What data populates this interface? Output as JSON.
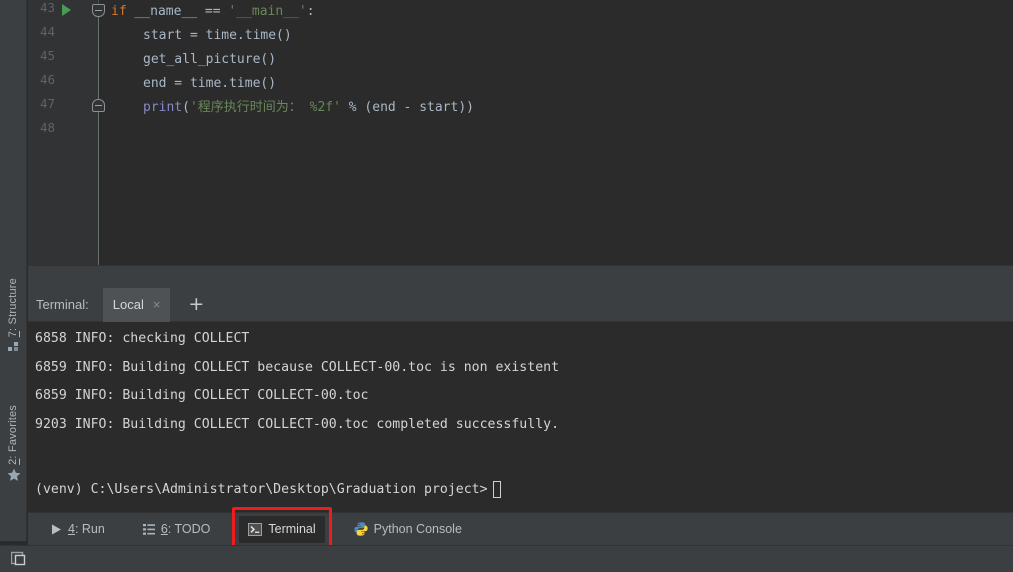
{
  "editor": {
    "lines": [
      {
        "num": "43",
        "tokens": [
          {
            "t": "if",
            "c": "kw"
          },
          {
            "t": " __name__ == ",
            "c": "pl"
          },
          {
            "t": "'__main__'",
            "c": "str"
          },
          {
            "t": ":",
            "c": "pl"
          }
        ],
        "indent": 0
      },
      {
        "num": "44",
        "tokens": [
          {
            "t": "start = time.time()",
            "c": "pl"
          }
        ],
        "indent": 1
      },
      {
        "num": "45",
        "tokens": [
          {
            "t": "get_all_picture()",
            "c": "pl"
          }
        ],
        "indent": 1
      },
      {
        "num": "46",
        "tokens": [
          {
            "t": "end = time.time()",
            "c": "pl"
          }
        ],
        "indent": 1
      },
      {
        "num": "47",
        "tokens": [
          {
            "t": "print",
            "c": "bi"
          },
          {
            "t": "(",
            "c": "pl"
          },
          {
            "t": "'程序执行时间为： %2f'",
            "c": "str"
          },
          {
            "t": " % (end - start))",
            "c": "pl"
          }
        ],
        "indent": 1
      },
      {
        "num": "48",
        "tokens": [],
        "indent": 0
      }
    ],
    "run_marker_line": "43",
    "fold_markers": [
      "43",
      "47"
    ]
  },
  "sidebar": {
    "items": [
      {
        "name": "structure",
        "key": "7",
        "label": "7: Structure",
        "icon": "structure-icon"
      },
      {
        "name": "favorites",
        "key": "2",
        "label": "2: Favorites",
        "icon": "star-icon"
      }
    ]
  },
  "terminal": {
    "label": "Terminal:",
    "tab": {
      "title": "Local",
      "close": "×"
    },
    "add_button": "+",
    "output_lines": [
      "6858 INFO: checking COLLECT",
      "6859 INFO: Building COLLECT because COLLECT-00.toc is non existent",
      "6859 INFO: Building COLLECT COLLECT-00.toc",
      "9203 INFO: Building COLLECT COLLECT-00.toc completed successfully.",
      ""
    ],
    "prompt": "(venv) C:\\Users\\Administrator\\Desktop\\Graduation project>"
  },
  "bottom_bar": {
    "buttons": [
      {
        "name": "run",
        "key": "4",
        "pre": "",
        "keytxt": "4",
        "post": ": Run",
        "icon": "play-icon",
        "active": false
      },
      {
        "name": "todo",
        "key": "6",
        "pre": "",
        "keytxt": "6",
        "post": ": TODO",
        "icon": "list-icon",
        "active": false
      },
      {
        "name": "terminal",
        "key": "",
        "pre": "Terminal",
        "keytxt": "",
        "post": "",
        "icon": "terminal-icon",
        "active": true
      },
      {
        "name": "python-console",
        "key": "",
        "pre": "Python Console",
        "keytxt": "",
        "post": "",
        "icon": "python-icon",
        "active": false
      }
    ],
    "highlight_target": "terminal"
  },
  "colors": {
    "background": "#2b2b2b",
    "panel": "#3c3f41",
    "gutter": "#313335",
    "text": "#a9b7c6",
    "keyword": "#cc7832",
    "string": "#6a8759",
    "builtin": "#8888c6",
    "run_green": "#499c54",
    "highlight_red": "#ee1c1c",
    "tab_active": "#4e5254"
  },
  "status_bar": {
    "icon": "layout-toggle-icon"
  }
}
